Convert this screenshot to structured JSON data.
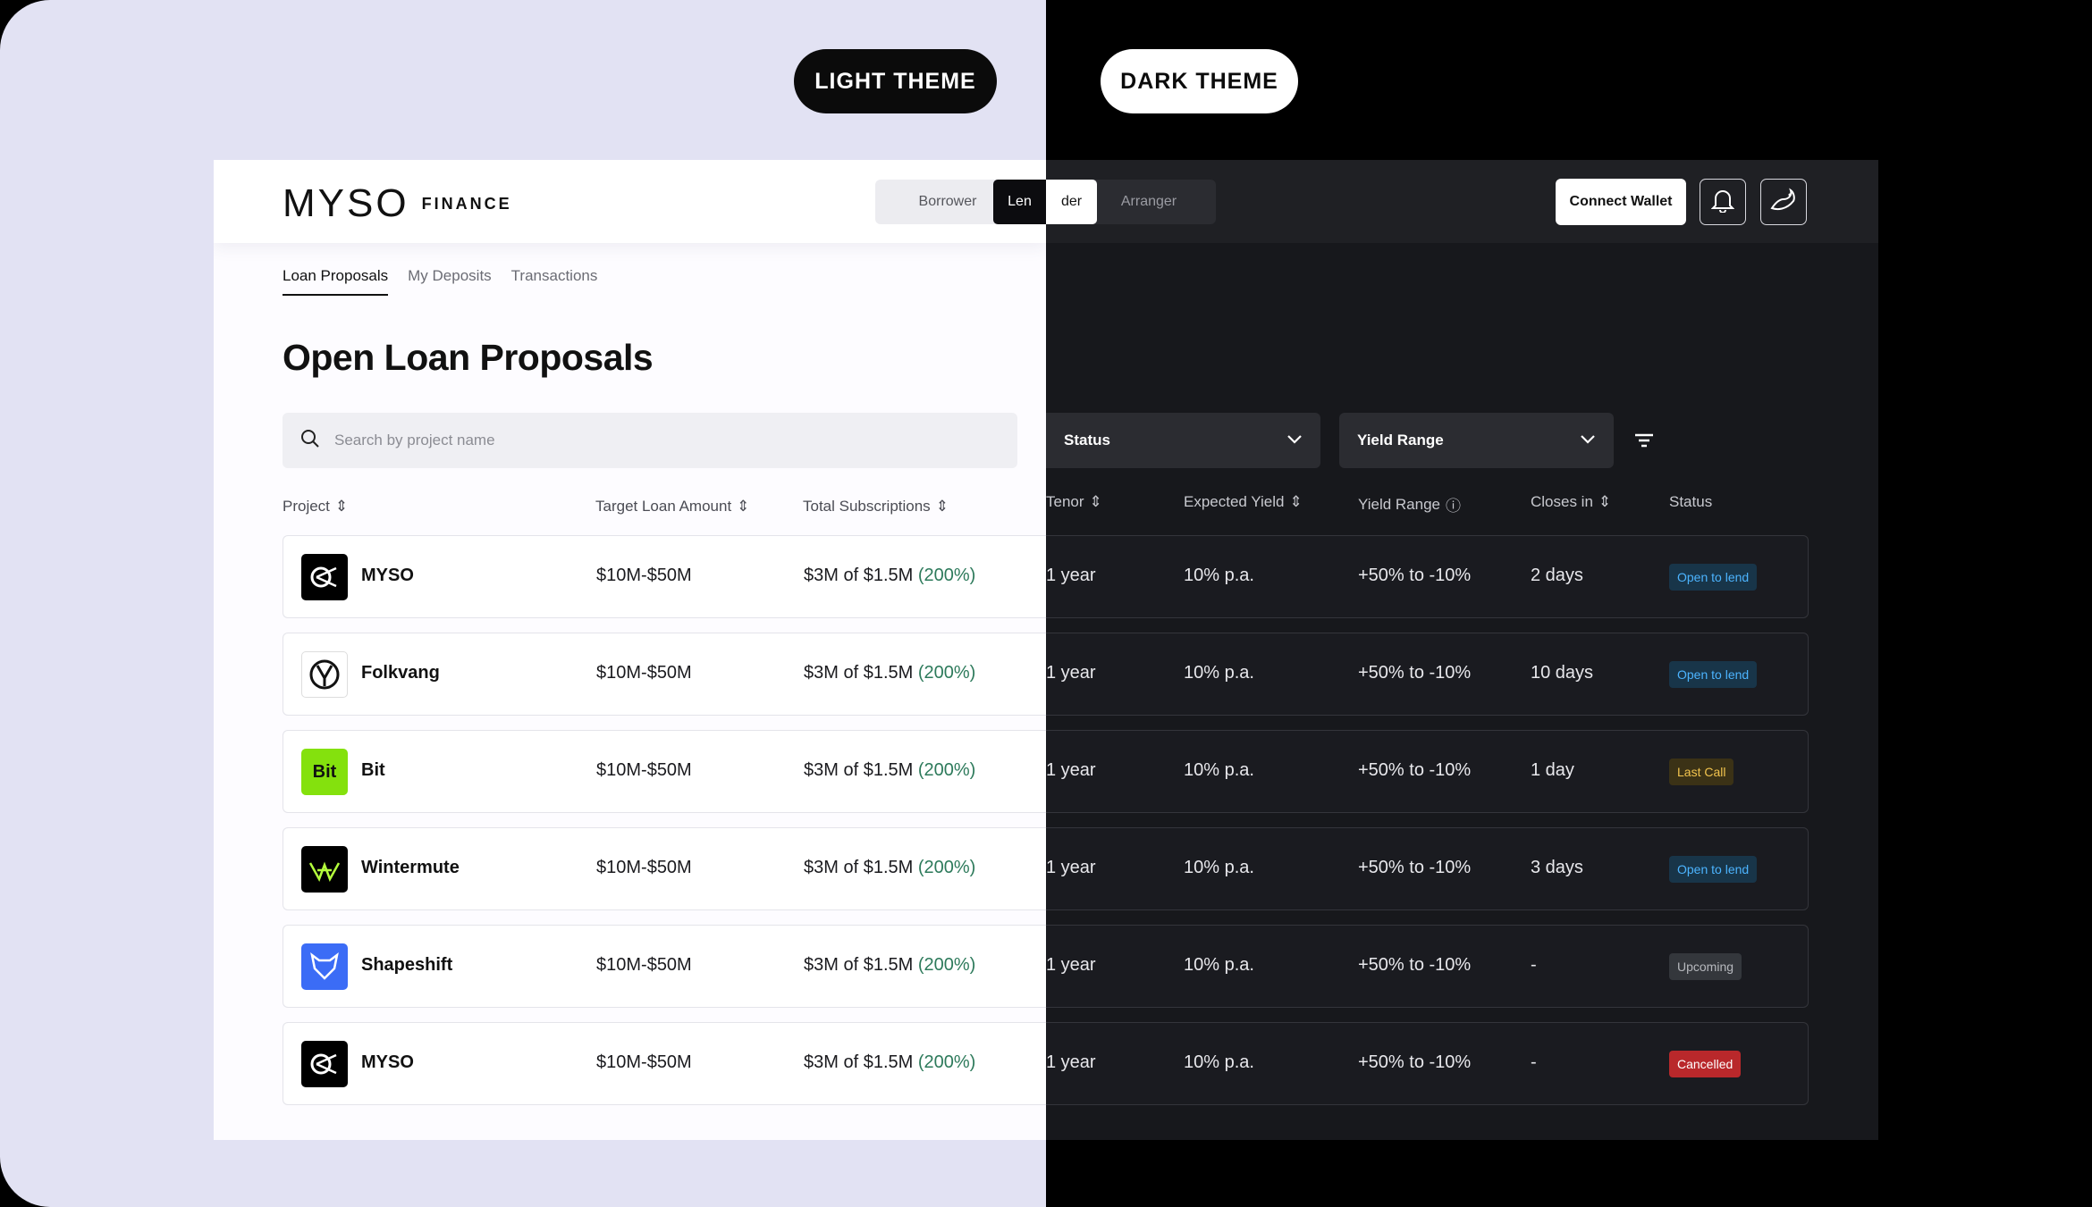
{
  "themes": {
    "light_label": "LIGHT THEME",
    "dark_label": "DARK THEME"
  },
  "brand": {
    "logo_word": "MYSO",
    "logo_sub": "FINANCE"
  },
  "role_switch": {
    "borrower": "Borrower",
    "lender_left": "Len",
    "lender_right": "der",
    "arranger": "Arranger",
    "selected": "Lender"
  },
  "header": {
    "connect_wallet": "Connect Wallet"
  },
  "tabs": [
    {
      "label": "Loan Proposals"
    },
    {
      "label": "My Deposits"
    },
    {
      "label": "Transactions"
    }
  ],
  "page": {
    "title": "Open Loan Proposals"
  },
  "search": {
    "placeholder": "Search by project name"
  },
  "filters": {
    "status": "Status",
    "yield_range": "Yield Range"
  },
  "columns": {
    "project": "Project",
    "target": "Target Loan Amount",
    "subs": "Total Subscriptions",
    "tenor": "Tenor",
    "expected_yield": "Expected Yield",
    "yield_range": "Yield Range",
    "closes_in": "Closes in",
    "status": "Status"
  },
  "rows": [
    {
      "project": "MYSO",
      "target": "$10M-$50M",
      "subs": "$3M of $1.5M",
      "pct": "(200%)",
      "tenor": "1 year",
      "yield": "10% p.a.",
      "range": "+50% to -10%",
      "closes": "2 days",
      "status": "Open to lend"
    },
    {
      "project": "Folkvang",
      "target": "$10M-$50M",
      "subs": "$3M of $1.5M",
      "pct": "(200%)",
      "tenor": "1 year",
      "yield": "10% p.a.",
      "range": "+50% to -10%",
      "closes": "10 days",
      "status": "Open to lend"
    },
    {
      "project": "Bit",
      "target": "$10M-$50M",
      "subs": "$3M of $1.5M",
      "pct": "(200%)",
      "tenor": "1 year",
      "yield": "10% p.a.",
      "range": "+50% to -10%",
      "closes": "1 day",
      "status": "Last Call"
    },
    {
      "project": "Wintermute",
      "target": "$10M-$50M",
      "subs": "$3M of $1.5M",
      "pct": "(200%)",
      "tenor": "1 year",
      "yield": "10% p.a.",
      "range": "+50% to -10%",
      "closes": "3 days",
      "status": "Open to lend"
    },
    {
      "project": "Shapeshift",
      "target": "$10M-$50M",
      "subs": "$3M of $1.5M",
      "pct": "(200%)",
      "tenor": "1 year",
      "yield": "10% p.a.",
      "range": "+50% to -10%",
      "closes": "-",
      "status": "Upcoming"
    },
    {
      "project": "MYSO",
      "target": "$10M-$50M",
      "subs": "$3M of $1.5M",
      "pct": "(200%)",
      "tenor": "1 year",
      "yield": "10% p.a.",
      "range": "+50% to -10%",
      "closes": "-",
      "status": "Cancelled"
    }
  ],
  "colors": {
    "accent_green": "#2d7a5b",
    "open": "#4cb4ff",
    "last_call": "#f2c44e",
    "cancelled": "#b9282b",
    "bit_logo": "#84e10d",
    "shapeshift_logo": "#3b6cf6"
  }
}
